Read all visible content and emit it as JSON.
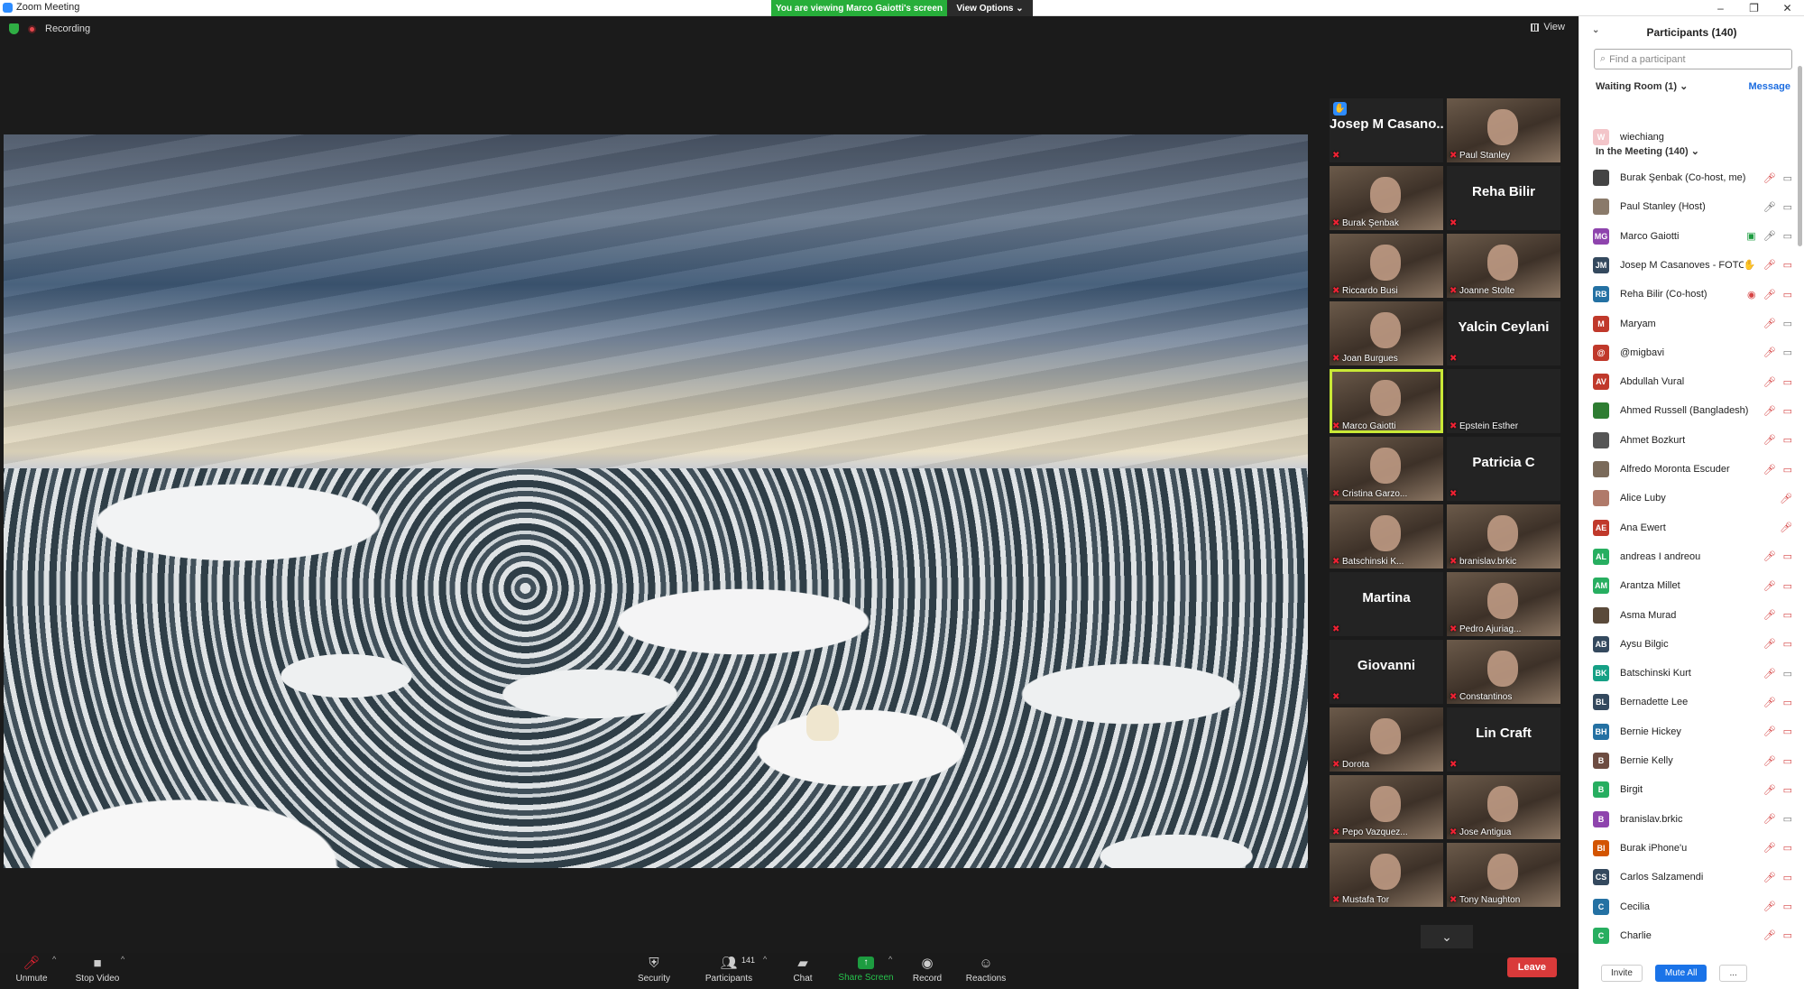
{
  "window": {
    "title": "Zoom Meeting"
  },
  "banner": {
    "message": "You are viewing Marco Gaiotti's screen",
    "view_options": "View Options ⌄"
  },
  "main": {
    "recording": "Recording",
    "view": "View"
  },
  "gallery": {
    "tiles": [
      {
        "name": "Josep  M  Casano...",
        "big": true,
        "hand": true
      },
      {
        "name": "Paul Stanley",
        "video": true
      },
      {
        "name": "Burak Şenbak",
        "video": true
      },
      {
        "name": "Reha Bilir",
        "big": true
      },
      {
        "name": "Riccardo Busi",
        "video": true
      },
      {
        "name": "Joanne Stolte",
        "video": true
      },
      {
        "name": "Joan Burgues",
        "video": true
      },
      {
        "name": "Yalcin Ceylani",
        "big": true
      },
      {
        "name": "Marco Gaiotti",
        "video": true,
        "active": true
      },
      {
        "name": "Epstein Esther",
        "video": false
      },
      {
        "name": "Cristina Garzo...",
        "video": true
      },
      {
        "name": "Patricia C",
        "big": true
      },
      {
        "name": "Batschinski K...",
        "video": true
      },
      {
        "name": "branislav.brkic",
        "video": true
      },
      {
        "name": "Martina",
        "big": true
      },
      {
        "name": "Pedro Ajuriag...",
        "video": true
      },
      {
        "name": "Giovanni",
        "big": true
      },
      {
        "name": "Constantinos",
        "video": true
      },
      {
        "name": "Dorota",
        "video": true
      },
      {
        "name": "Lin Craft",
        "big": true
      },
      {
        "name": "Pepo Vazquez...",
        "video": true
      },
      {
        "name": "Jose Antigua",
        "video": true
      },
      {
        "name": "Mustafa Tor",
        "video": true
      },
      {
        "name": "Tony Naughton",
        "video": true
      }
    ]
  },
  "toolbar": {
    "unmute": "Unmute",
    "stop_video": "Stop Video",
    "security": "Security",
    "participants": "Participants",
    "participants_count": "141",
    "chat": "Chat",
    "share_screen": "Share Screen",
    "record": "Record",
    "reactions": "Reactions",
    "leave": "Leave"
  },
  "panel": {
    "title": "Participants (140)",
    "search_placeholder": "Find a participant",
    "waiting_room": "Waiting Room (1)  ⌄",
    "message": "Message",
    "in_meeting": "In the Meeting (140)  ⌄",
    "waiting": [
      {
        "name": "wiechiang",
        "initials": "W",
        "color": "#f3c5c9"
      }
    ],
    "participants": [
      {
        "name": "Burak Şenbak (Co-host, me)",
        "initials": "",
        "color": "#444",
        "mic": "off",
        "cam": "on"
      },
      {
        "name": "Paul Stanley (Host)",
        "initials": "",
        "color": "#8a7a6a",
        "mic": "on",
        "cam": "on"
      },
      {
        "name": "Marco Gaiotti",
        "initials": "MG",
        "color": "#8e44ad",
        "mic": "on",
        "cam": "on",
        "share": true
      },
      {
        "name": "Josep M Casanoves - FOTO...",
        "initials": "JM",
        "color": "#34495e",
        "mic": "off",
        "cam": "off",
        "hand": true
      },
      {
        "name": "Reha Bilir (Co-host)",
        "initials": "RB",
        "color": "#2471a3",
        "mic": "off",
        "cam": "off",
        "rec": true
      },
      {
        "name": "Maryam",
        "initials": "M",
        "color": "#c0392b",
        "mic": "off",
        "cam": "on"
      },
      {
        "name": "@migbavi",
        "initials": "@",
        "color": "#c0392b",
        "mic": "off",
        "cam": "on"
      },
      {
        "name": "Abdullah Vural",
        "initials": "AV",
        "color": "#c0392b",
        "mic": "off",
        "cam": "off"
      },
      {
        "name": "Ahmed Russell (Bangladesh)",
        "initials": "",
        "color": "#2e7d32",
        "mic": "off",
        "cam": "off"
      },
      {
        "name": "Ahmet Bozkurt",
        "initials": "",
        "color": "#555",
        "mic": "off",
        "cam": "off"
      },
      {
        "name": "Alfredo Moronta Escuder",
        "initials": "",
        "color": "#7a6a5a",
        "mic": "off",
        "cam": "off"
      },
      {
        "name": "Alice Luby",
        "initials": "",
        "color": "#b07a6a",
        "mic": "off",
        "cam": ""
      },
      {
        "name": "Ana Ewert",
        "initials": "AE",
        "color": "#c0392b",
        "mic": "off",
        "cam": ""
      },
      {
        "name": "andreas I andreou",
        "initials": "AL",
        "color": "#27ae60",
        "mic": "off",
        "cam": "off"
      },
      {
        "name": "Arantza Millet",
        "initials": "AM",
        "color": "#27ae60",
        "mic": "off",
        "cam": "off"
      },
      {
        "name": "Asma Murad",
        "initials": "",
        "color": "#5a4a3a",
        "mic": "off",
        "cam": "off"
      },
      {
        "name": "Aysu Bilgic",
        "initials": "AB",
        "color": "#34495e",
        "mic": "off",
        "cam": "off"
      },
      {
        "name": "Batschinski Kurt",
        "initials": "BK",
        "color": "#16a085",
        "mic": "off",
        "cam": "on"
      },
      {
        "name": "Bernadette Lee",
        "initials": "BL",
        "color": "#34495e",
        "mic": "off",
        "cam": "off"
      },
      {
        "name": "Bernie Hickey",
        "initials": "BH",
        "color": "#2471a3",
        "mic": "off",
        "cam": "off"
      },
      {
        "name": "Bernie Kelly",
        "initials": "B",
        "color": "#6d4c41",
        "mic": "off",
        "cam": "off"
      },
      {
        "name": "Birgit",
        "initials": "B",
        "color": "#27ae60",
        "mic": "off",
        "cam": "off"
      },
      {
        "name": "branislav.brkic",
        "initials": "B",
        "color": "#8e44ad",
        "mic": "off",
        "cam": "on"
      },
      {
        "name": "Burak iPhone'u",
        "initials": "BI",
        "color": "#d35400",
        "mic": "off",
        "cam": "off"
      },
      {
        "name": "Carlos Salzamendi",
        "initials": "CS",
        "color": "#34495e",
        "mic": "off",
        "cam": "off"
      },
      {
        "name": "Cecilia",
        "initials": "C",
        "color": "#2471a3",
        "mic": "off",
        "cam": "off"
      },
      {
        "name": "Charlie",
        "initials": "C",
        "color": "#27ae60",
        "mic": "off",
        "cam": "off"
      }
    ],
    "invite": "Invite",
    "mute_all": "Mute All",
    "more": "..."
  }
}
